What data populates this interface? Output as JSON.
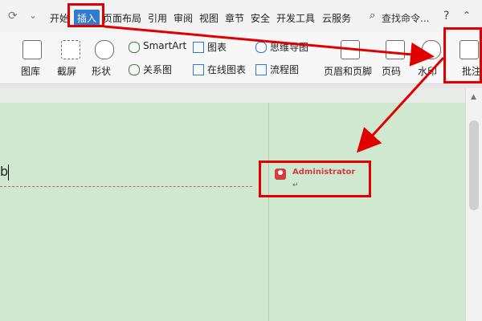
{
  "topbar": {
    "tabs": [
      "开始",
      "插入",
      "页面布局",
      "引用",
      "审阅",
      "视图",
      "章节",
      "安全",
      "开发工具",
      "云服务"
    ],
    "search": "查找命令...",
    "help": "?"
  },
  "ribbon": {
    "picture": "图库",
    "screenshot": "截屏",
    "shape": "形状",
    "smartart": "SmartArt",
    "chart": "图表",
    "mindmap": "思维导图",
    "relation": "关系图",
    "online_chart": "在线图表",
    "flowchart": "流程图",
    "header_footer": "页眉和页脚",
    "page_number": "页码",
    "watermark": "水印",
    "comment": "批注"
  },
  "document": {
    "text_fragment": "b"
  },
  "comment": {
    "author": "Administrator",
    "return_mark": "↵"
  },
  "colors": {
    "highlight": "#e00000",
    "accent": "#2f7bd0",
    "doc_bg": "#cfe8cf"
  }
}
